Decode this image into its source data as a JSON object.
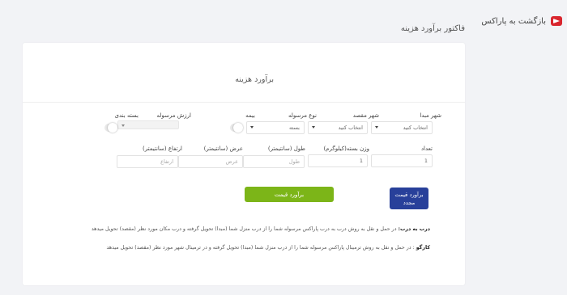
{
  "header": {
    "back_label": "بازگشت به پاراکس",
    "page_title": "فاکتور برآورد هزینه"
  },
  "card": {
    "title": "برآورد هزینه"
  },
  "form": {
    "origin_city": {
      "label": "شهر مبدا",
      "value": "انتخاب کنید"
    },
    "dest_city": {
      "label": "شهر مقصد",
      "value": "انتخاب کنید"
    },
    "shipment_type": {
      "label": "نوع مرسوله",
      "value": "بسته"
    },
    "insurance": {
      "label": "بیمه"
    },
    "shipment_value": {
      "label": "ارزش مرسوله",
      "value": ""
    },
    "packaging": {
      "label": "بسته بندی"
    },
    "count": {
      "label": "تعداد",
      "value": "1"
    },
    "weight": {
      "label": "وزن بسته(کیلوگرم)",
      "value": "1"
    },
    "length": {
      "label": "طول (سانتیمتر)",
      "placeholder": "طول"
    },
    "width": {
      "label": "عرض (سانتیمتر)",
      "placeholder": "عرض"
    },
    "height": {
      "label": "ارتفاع (سانتیمتر)",
      "placeholder": "ارتفاع"
    }
  },
  "buttons": {
    "reset_label": "برآورد قیمت مجدد",
    "estimate_label": "برآورد قیمت"
  },
  "notes": [
    {
      "title": "درب به درب:",
      "text": " در حمل و نقل به روش درب به درب پاراکس مرسوله شما را از درب منزل شما (مبدا) تحویل گرفته و درب مکان مورد نظر (مقصد) تحویل میدهد"
    },
    {
      "title": "کارگو",
      "text": " : در حمل و نقل به روش ترمینال پاراکس مرسوله شما را از درب منزل شما (مبدا) تحویل گرفته و در ترمینال شهر مورد نظر (مقصد) تحویل میدهد"
    }
  ],
  "colors": {
    "background": "#f2f3f6",
    "reset_button": "#28409a",
    "estimate_button": "#7cb518",
    "logo": "#d9262e"
  }
}
